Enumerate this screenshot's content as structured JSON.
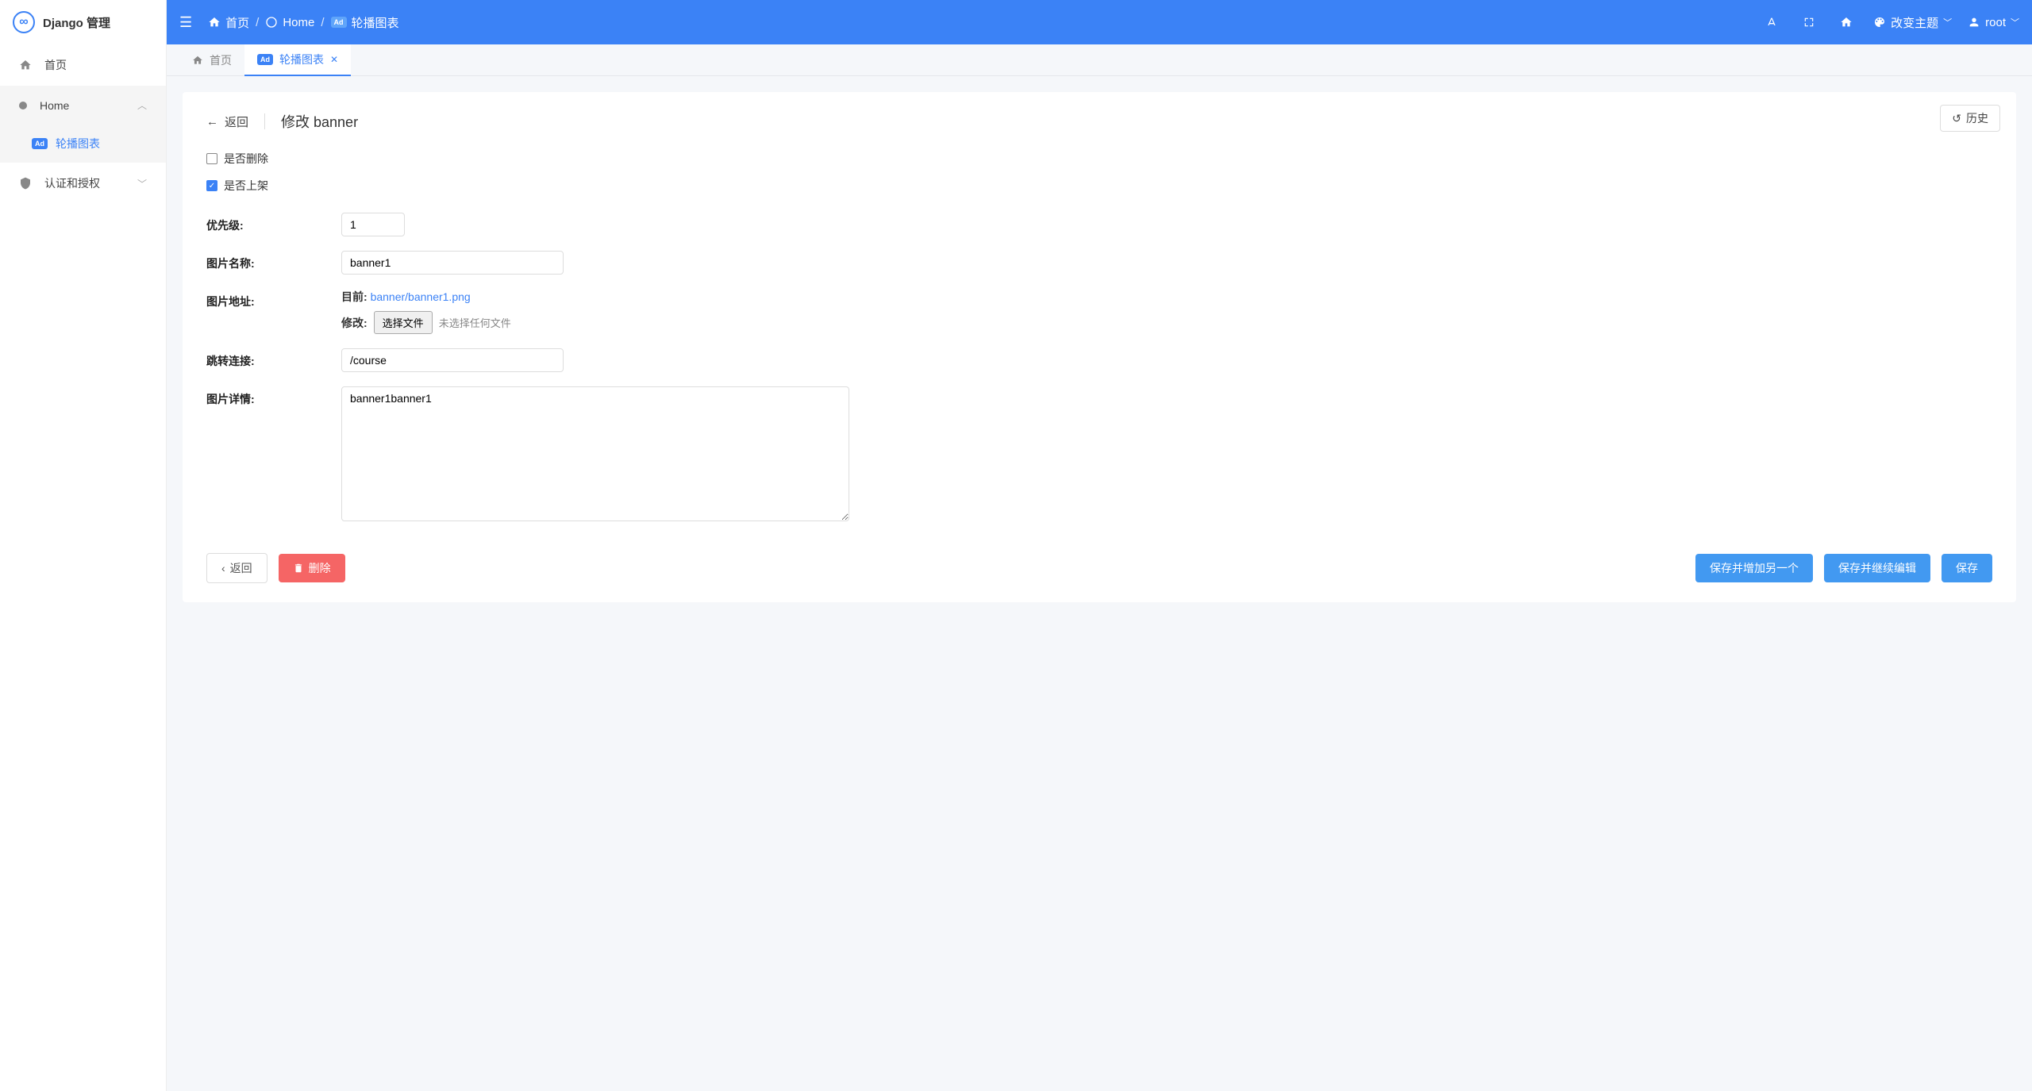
{
  "brand": "Django 管理",
  "sidebar": {
    "items": [
      {
        "label": "首页",
        "icon": "home"
      },
      {
        "label": "Home",
        "icon": "dot",
        "expanded": true,
        "children": [
          {
            "label": "轮播图表"
          }
        ]
      },
      {
        "label": "认证和授权",
        "icon": "shield",
        "expanded": false
      }
    ]
  },
  "topbar": {
    "breadcrumb": [
      {
        "label": "首页",
        "icon": "home"
      },
      {
        "label": "Home",
        "icon": "circle"
      },
      {
        "label": "轮播图表",
        "icon": "ad"
      }
    ],
    "theme_label": "改变主题",
    "user_label": "root"
  },
  "tabs": {
    "fixed": {
      "label": "首页"
    },
    "active": {
      "label": "轮播图表"
    }
  },
  "page": {
    "back_label": "返回",
    "title": "修改 banner",
    "history_label": "历史"
  },
  "form": {
    "is_deleted": {
      "label": "是否删除",
      "checked": false
    },
    "is_active": {
      "label": "是否上架",
      "checked": true
    },
    "priority": {
      "label": "优先级:",
      "value": "1"
    },
    "name": {
      "label": "图片名称:",
      "value": "banner1"
    },
    "image_url": {
      "label": "图片地址:",
      "current_prefix": "目前:",
      "current_value": "banner/banner1.png",
      "edit_prefix": "修改:",
      "file_button": "选择文件",
      "file_status": "未选择任何文件"
    },
    "link": {
      "label": "跳转连接:",
      "value": "/course"
    },
    "detail": {
      "label": "图片详情:",
      "value": "banner1banner1"
    }
  },
  "actions": {
    "back": "返回",
    "delete": "删除",
    "save_add_another": "保存并增加另一个",
    "save_continue": "保存并继续编辑",
    "save": "保存"
  }
}
